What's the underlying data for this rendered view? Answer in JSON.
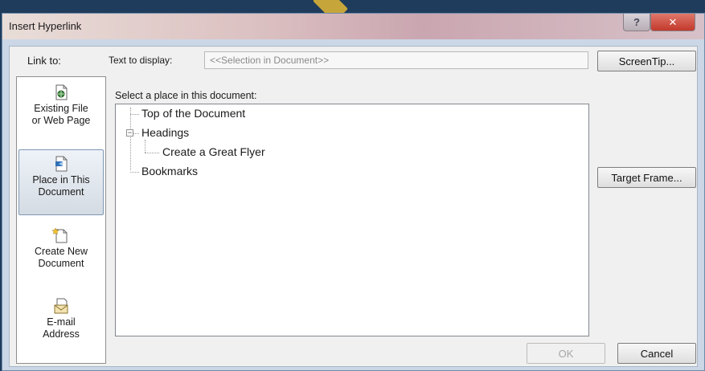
{
  "window": {
    "title": "Insert Hyperlink",
    "help_glyph": "?",
    "close_glyph": "✕"
  },
  "link_to": {
    "label": "Link to:",
    "items": [
      {
        "icon": "existing-file-icon",
        "line1": "Existing File",
        "line2": "or Web Page"
      },
      {
        "icon": "place-in-document-icon",
        "line1": "Place in This",
        "line2": "Document"
      },
      {
        "icon": "create-new-document-icon",
        "line1": "Create New",
        "line2": "Document"
      },
      {
        "icon": "email-address-icon",
        "line1": "E-mail",
        "line2": "Address"
      }
    ]
  },
  "text_to_display": {
    "label": "Text to display:",
    "value": "<<Selection in Document>>"
  },
  "place_label": "Select a place in this document:",
  "tree": {
    "top": "Top of the Document",
    "headings": "Headings",
    "heading_child": "Create a Great Flyer",
    "bookmarks": "Bookmarks",
    "collapse_glyph": "−"
  },
  "buttons": {
    "screentip": "ScreenTip...",
    "target_frame": "Target Frame...",
    "ok": "OK",
    "cancel": "Cancel"
  },
  "colors": {
    "selected_link_bg": "#d4dbe3",
    "close_button": "#c2392b",
    "desktop": "#1f3c5c"
  }
}
